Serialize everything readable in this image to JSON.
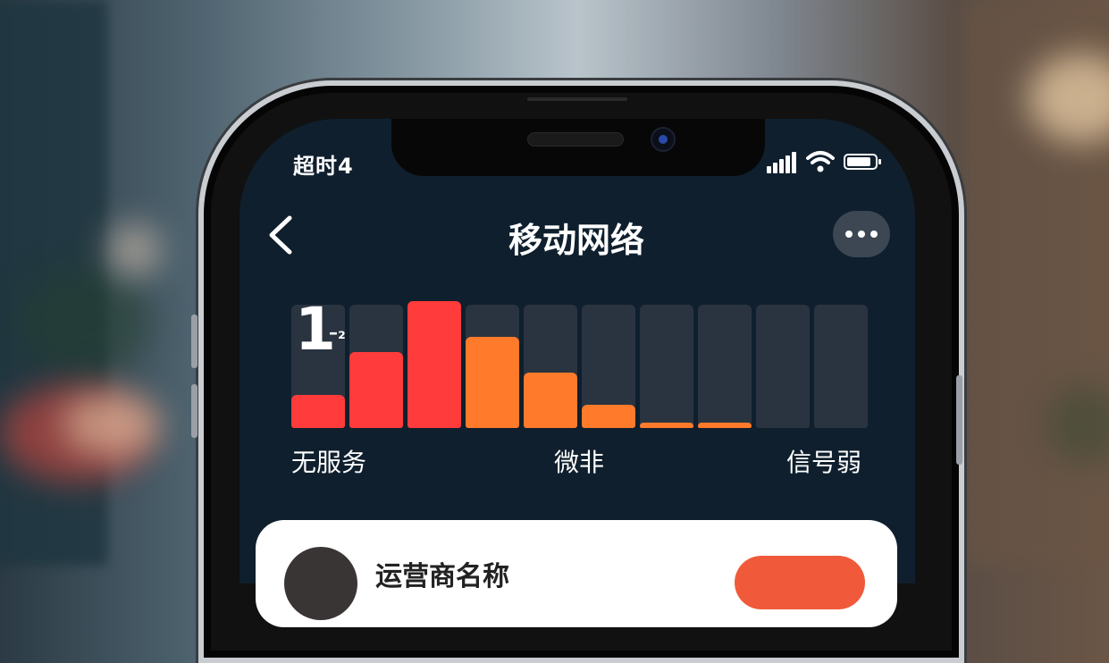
{
  "status_bar": {
    "time": "超时4"
  },
  "header": {
    "title": "移动网络"
  },
  "chart_data": {
    "type": "bar",
    "title": "",
    "xlabel": "",
    "ylabel": "",
    "ylim": [
      0,
      100
    ],
    "values": [
      26,
      60,
      100,
      72,
      44,
      18,
      4,
      4,
      0,
      0
    ],
    "colors": [
      "#ff3b3b",
      "#ff3b3b",
      "#ff3b3b",
      "#ff7a2a",
      "#ff7a2a",
      "#ff7a2a",
      "#ff7a2a",
      "#ff7a2a",
      "#2a3440",
      "#2a3440"
    ],
    "track_color": "#2a3440"
  },
  "signal_readout": {
    "big": "1",
    "small": "–₂"
  },
  "scale_labels": {
    "left": "无服务",
    "middle": "微非",
    "right": "信号弱"
  },
  "card": {
    "title": "运营商名称"
  }
}
